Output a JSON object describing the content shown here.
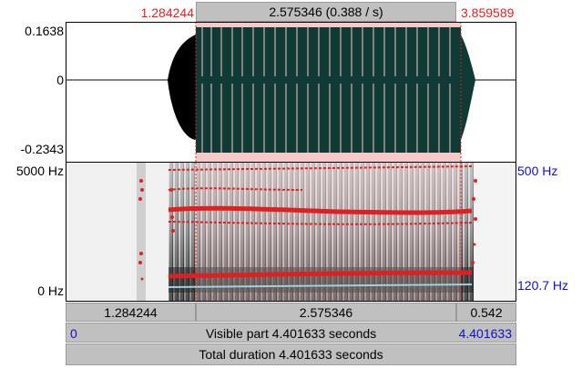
{
  "selection": {
    "start": "1.284244",
    "end": "3.859589",
    "duration_label": "2.575346 (0.388 / s)"
  },
  "waveform": {
    "y_max": "0.1638",
    "y_zero": "0",
    "y_min": "-0.2343"
  },
  "spectrogram": {
    "freq_max": "5000 Hz",
    "freq_min": "0 Hz",
    "pitch_max": "500 Hz",
    "pitch_current": "120.7 Hz"
  },
  "segments": {
    "before": "1.284244",
    "selected": "2.575346",
    "after": "0.542"
  },
  "visible": {
    "start": "0",
    "label": "Visible part 4.401633 seconds",
    "end": "4.401633"
  },
  "total": {
    "label": "Total duration 4.401633 seconds"
  },
  "colors": {
    "selection_tint": "#f7c9c9",
    "waveform": "#0f3a35",
    "formant": "#e02020"
  }
}
